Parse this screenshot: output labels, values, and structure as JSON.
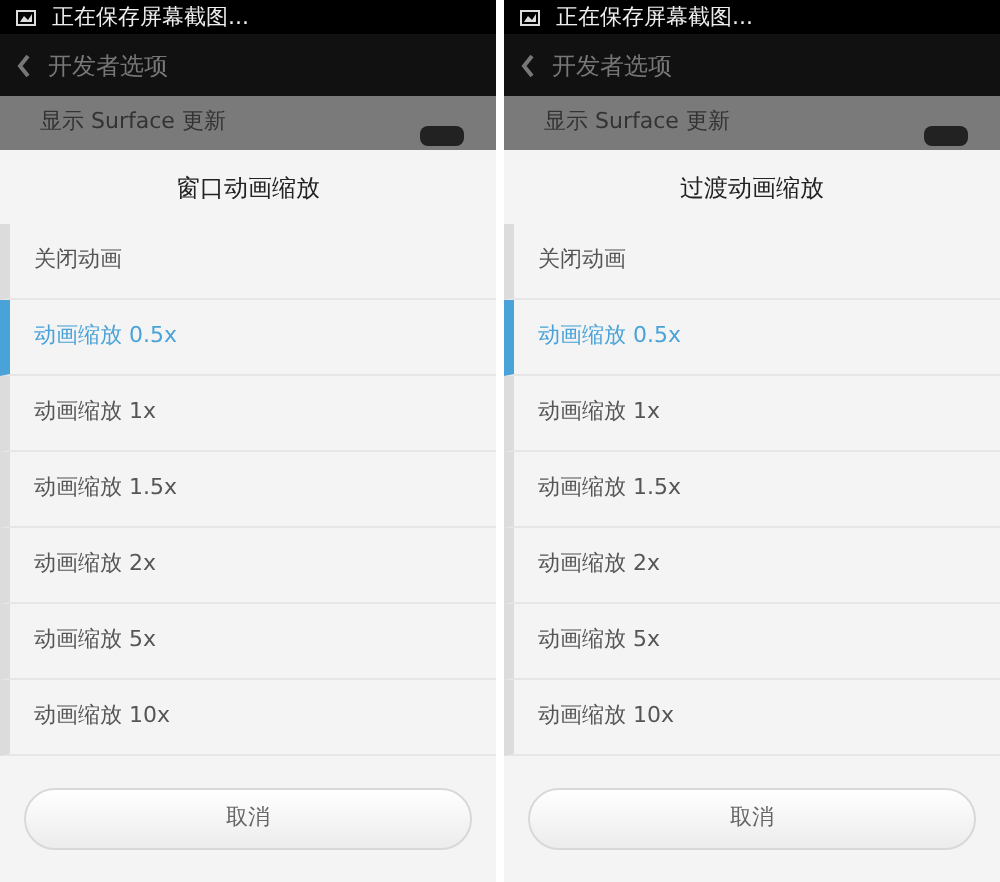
{
  "panels": [
    {
      "status_text": "正在保存屏幕截图...",
      "header_title": "开发者选项",
      "background_item": "显示 Surface 更新",
      "toggle_on": true,
      "dialog": {
        "title": "窗口动画缩放",
        "options": [
          {
            "label": "关闭动画",
            "selected": false
          },
          {
            "label": "动画缩放 0.5x",
            "selected": true
          },
          {
            "label": "动画缩放 1x",
            "selected": false
          },
          {
            "label": "动画缩放 1.5x",
            "selected": false
          },
          {
            "label": "动画缩放 2x",
            "selected": false
          },
          {
            "label": "动画缩放 5x",
            "selected": false
          },
          {
            "label": "动画缩放 10x",
            "selected": false
          }
        ],
        "cancel": "取消"
      }
    },
    {
      "status_text": "正在保存屏幕截图...",
      "header_title": "开发者选项",
      "background_item": "显示 Surface 更新",
      "toggle_on": true,
      "dialog": {
        "title": "过渡动画缩放",
        "options": [
          {
            "label": "关闭动画",
            "selected": false
          },
          {
            "label": "动画缩放 0.5x",
            "selected": true
          },
          {
            "label": "动画缩放 1x",
            "selected": false
          },
          {
            "label": "动画缩放 1.5x",
            "selected": false
          },
          {
            "label": "动画缩放 2x",
            "selected": false
          },
          {
            "label": "动画缩放 5x",
            "selected": false
          },
          {
            "label": "动画缩放 10x",
            "selected": false
          }
        ],
        "cancel": "取消"
      }
    }
  ]
}
